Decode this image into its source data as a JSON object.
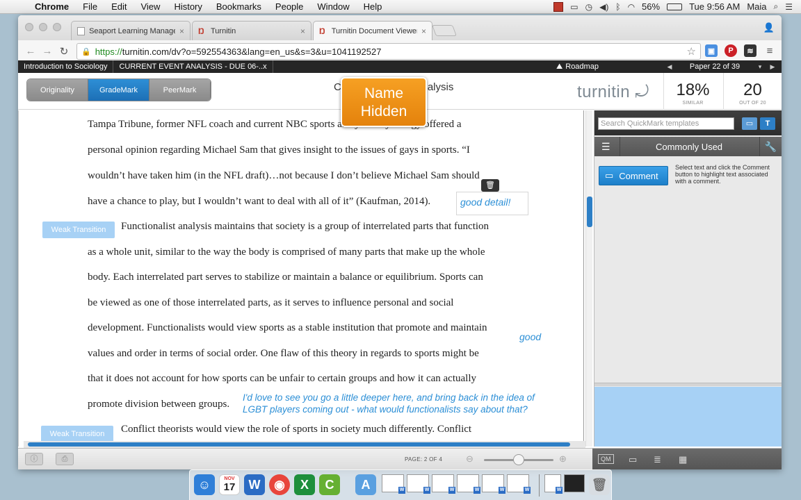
{
  "menubar": {
    "app_name": "Chrome",
    "menus": [
      "File",
      "Edit",
      "View",
      "History",
      "Bookmarks",
      "People",
      "Window",
      "Help"
    ],
    "battery": "56%",
    "clock": "Tue 9:56 AM",
    "user": "Maia"
  },
  "browser": {
    "tabs": [
      {
        "label": "Seaport Learning Managem",
        "icon": "document-icon"
      },
      {
        "label": "Turnitin",
        "icon": "turnitin-icon"
      },
      {
        "label": "Turnitin Document Viewer",
        "icon": "turnitin-icon"
      }
    ],
    "url_scheme": "https://",
    "url_rest": "turnitin.com/dv?o=592554363&lang=en_us&s=3&u=1041192527"
  },
  "turnitin": {
    "class_name": "Introduction to Sociology",
    "assignment": "CURRENT EVENT ANALYSIS - DUE 06-..x",
    "roadmap_label": "Roadmap",
    "paper_position": "Paper 22 of 39",
    "modes": [
      "Originality",
      "GradeMark",
      "PeerMark"
    ],
    "active_mode": "GradeMark",
    "doc_title_left": "C",
    "doc_title_right": "alysis",
    "name_badge_line1": "Name",
    "name_badge_line2": "Hidden",
    "logo": "turnitin",
    "similarity_value": "18%",
    "similarity_label": "SIMILAR",
    "grade_value": "20",
    "grade_label": "OUT OF 20"
  },
  "document": {
    "lines": [
      "Tampa Tribune, former NFL coach and current NBC sports analyst Tony Dungy offered a",
      "personal opinion regarding Michael Sam that gives insight to the issues of gays in sports.  “I",
      "wouldn’t have taken him (in the NFL draft)…not because I don’t believe Michael Sam should",
      "have a chance to play, but I wouldn’t want to deal with all of it” (Kaufman, 2014).",
      "Functionalist analysis maintains that society is a group of interrelated parts that function",
      "as a whole unit, similar to the way the body is comprised of many parts that make up the whole",
      "body.  Each interrelated part serves to stabilize or maintain a balance or equilibrium.  Sports can",
      "be viewed as one of those interrelated parts, as it serves to influence personal and social",
      "development.  Functionalists would view sports as a stable institution that promote and maintain",
      "values and order in terms of social order.  One flaw of this theory in regards to sports might be",
      "that it does not account for how sports can be unfair to certain groups and how it can actually",
      "promote division between groups.",
      "Conflict theorists would view the role of sports in society much differently.  Conflict"
    ],
    "quickmark_1": "Weak Transition",
    "quickmark_2": "Weak Transition",
    "comment_1": "good detail!",
    "comment_2": "good",
    "comment_3_line1": "I'd love to see you go a little deeper here, and bring back in the idea of",
    "comment_3_line2": "LGBT players coming out - what would functionalists say about that?"
  },
  "sidepanel": {
    "search_placeholder": "Search QuickMark templates",
    "set_title": "Commonly Used",
    "comment_button": "Comment",
    "comment_help": "Select text and click the Comment button to highlight text associated with a comment."
  },
  "footer": {
    "page_label": "PAGE:  2 OF 4",
    "qm_label": "QM"
  },
  "dock": {
    "calendar_month": "NOV",
    "calendar_day": "17"
  },
  "colors": {
    "accent_blue": "#2d7fc6",
    "badge_orange": "#f08f1c",
    "quickmark_blue": "#a7d1f5",
    "comment_text_blue": "#2c8fd6"
  }
}
